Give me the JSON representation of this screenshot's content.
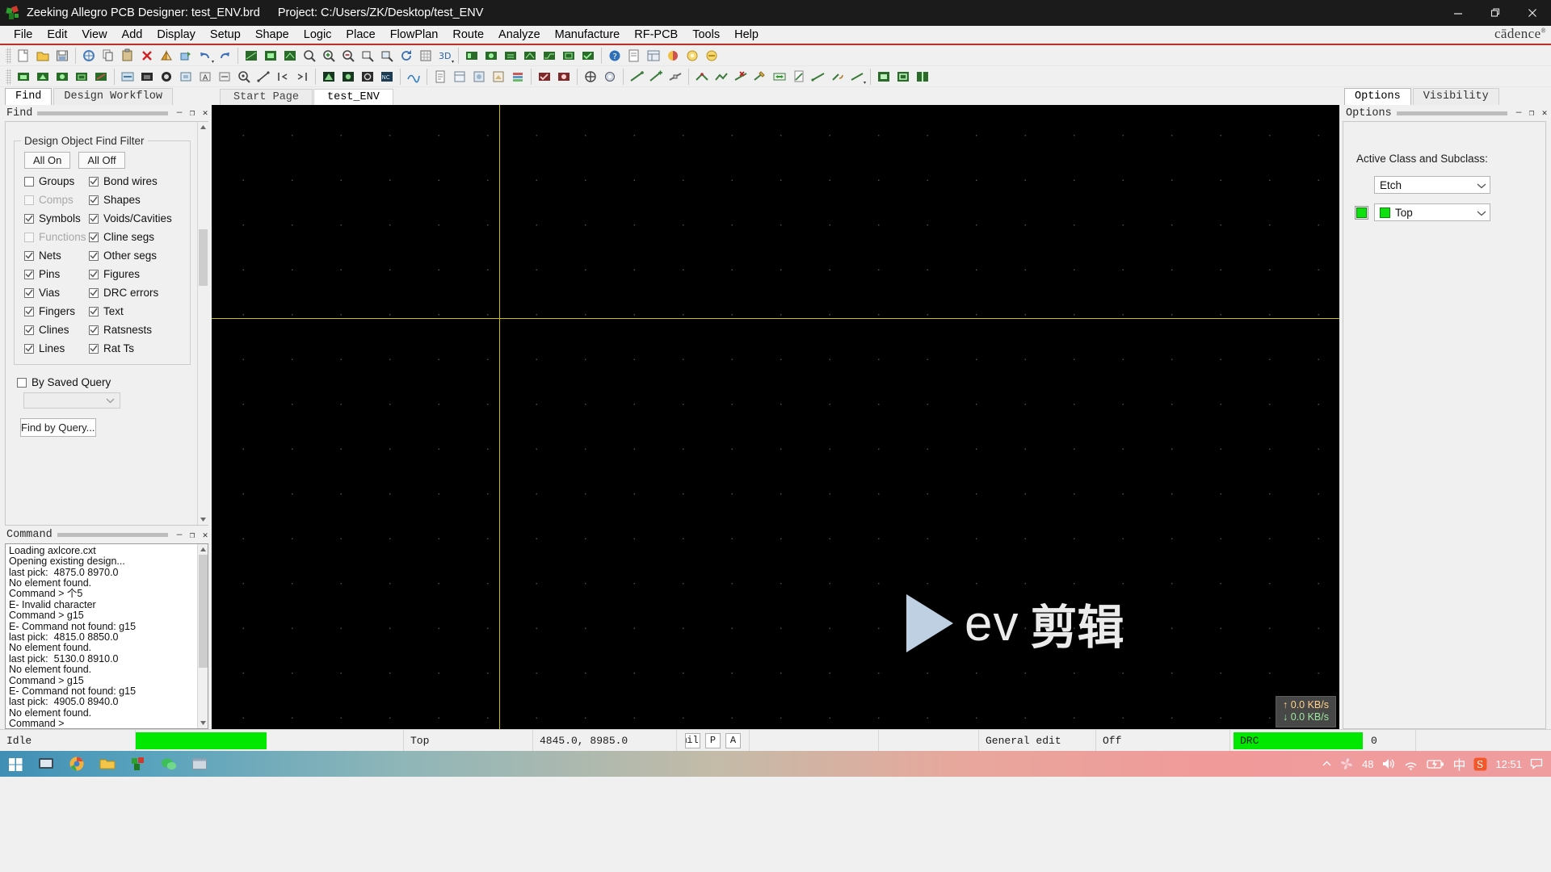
{
  "window": {
    "title_app": "Zeeking Allegro PCB Designer: test_ENV.brd",
    "title_project": "Project: C:/Users/ZK/Desktop/test_ENV",
    "minimize_label": "Minimize",
    "maximize_label": "Restore",
    "close_label": "Close"
  },
  "menubar": {
    "items": [
      "File",
      "Edit",
      "View",
      "Add",
      "Display",
      "Setup",
      "Shape",
      "Logic",
      "Place",
      "FlowPlan",
      "Route",
      "Analyze",
      "Manufacture",
      "RF-PCB",
      "Tools",
      "Help"
    ],
    "brand": "cādence",
    "brand_sup": "®"
  },
  "left_panel": {
    "tabs": [
      {
        "label": "Find",
        "active": true
      },
      {
        "label": "Design Workflow",
        "active": false
      }
    ],
    "dock_title": "Find",
    "group_title": "Design Object Find Filter",
    "all_on": "All On",
    "all_off": "All Off",
    "filters_left": [
      {
        "label": "Groups",
        "checked": false,
        "enabled": true
      },
      {
        "label": "Comps",
        "checked": false,
        "enabled": false
      },
      {
        "label": "Symbols",
        "checked": true,
        "enabled": true
      },
      {
        "label": "Functions",
        "checked": false,
        "enabled": false
      },
      {
        "label": "Nets",
        "checked": true,
        "enabled": true
      },
      {
        "label": "Pins",
        "checked": true,
        "enabled": true
      },
      {
        "label": "Vias",
        "checked": true,
        "enabled": true
      },
      {
        "label": "Fingers",
        "checked": true,
        "enabled": true
      },
      {
        "label": "Clines",
        "checked": true,
        "enabled": true
      },
      {
        "label": "Lines",
        "checked": true,
        "enabled": true
      }
    ],
    "filters_right": [
      {
        "label": "Bond wires",
        "checked": true,
        "enabled": true
      },
      {
        "label": "Shapes",
        "checked": true,
        "enabled": true
      },
      {
        "label": "Voids/Cavities",
        "checked": true,
        "enabled": true
      },
      {
        "label": "Cline segs",
        "checked": true,
        "enabled": true
      },
      {
        "label": "Other segs",
        "checked": true,
        "enabled": true
      },
      {
        "label": "Figures",
        "checked": true,
        "enabled": true
      },
      {
        "label": "DRC errors",
        "checked": true,
        "enabled": true
      },
      {
        "label": "Text",
        "checked": true,
        "enabled": true
      },
      {
        "label": "Ratsnests",
        "checked": true,
        "enabled": true
      },
      {
        "label": "Rat Ts",
        "checked": true,
        "enabled": true
      }
    ],
    "by_saved_query": {
      "label": "By Saved Query",
      "checked": false
    },
    "saved_query_value": "",
    "find_by_query": "Find by Query..."
  },
  "command_panel": {
    "dock_title": "Command",
    "lines": [
      "Loading axlcore.cxt",
      "Opening existing design...",
      "last pick:  4875.0 8970.0",
      "No element found.",
      "Command > 个5",
      "E- Invalid character",
      "Command > g15",
      "E- Command not found: g15",
      "last pick:  4815.0 8850.0",
      "No element found.",
      "last pick:  5130.0 8910.0",
      "No element found.",
      "Command > g15",
      "E- Command not found: g15",
      "last pick:  4905.0 8940.0",
      "No element found.",
      "Command >"
    ]
  },
  "canvas": {
    "tabs": [
      {
        "label": "Start Page",
        "active": false
      },
      {
        "label": "test_ENV",
        "active": true
      }
    ],
    "crosshair_color": "#c8c000",
    "background_color": "#000000",
    "watermark_text": "ev",
    "watermark_cn": "剪辑",
    "netspeed_up": "↑ 0.0 KB/s",
    "netspeed_down": "↓ 0.0 KB/s"
  },
  "right_panel": {
    "tabs": [
      {
        "label": "Options",
        "active": true
      },
      {
        "label": "Visibility",
        "active": false
      }
    ],
    "dock_title": "Options",
    "section_label": "Active Class and Subclass:",
    "class_value": "Etch",
    "subclass_value": "Top",
    "subclass_color": "#10e010"
  },
  "status_bar": {
    "mode": "Idle",
    "progress_color": "#00e800",
    "layer": "Top",
    "coords": "4845.0,  8985.0",
    "units_box": "mils",
    "pick_box": "P",
    "angle_box": "A",
    "edit_mode": "General edit",
    "off_label": "Off",
    "drc_label": "DRC",
    "drc_count": "0"
  },
  "taskbar": {
    "tray_battery": "48",
    "tray_ime": "中",
    "tray_time": "12:51"
  }
}
